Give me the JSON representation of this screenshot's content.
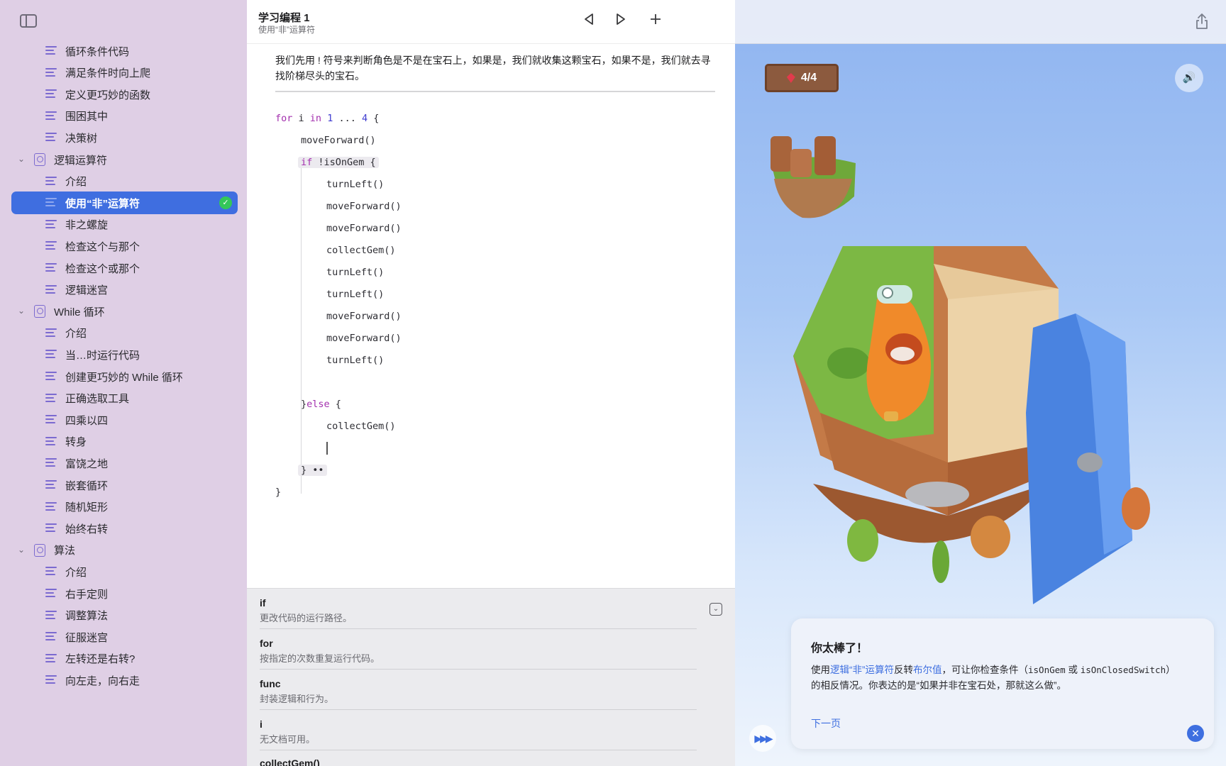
{
  "sidebar": {
    "items": [
      {
        "type": "page",
        "label": "循环条件代码"
      },
      {
        "type": "page",
        "label": "满足条件时向上爬"
      },
      {
        "type": "page",
        "label": "定义更巧妙的函数"
      },
      {
        "type": "page",
        "label": "围困其中"
      },
      {
        "type": "page",
        "label": "决策树"
      },
      {
        "type": "chapter",
        "label": "逻辑运算符"
      },
      {
        "type": "page",
        "label": "介绍"
      },
      {
        "type": "page",
        "label": "使用“非”运算符",
        "selected": true
      },
      {
        "type": "page",
        "label": "非之螺旋"
      },
      {
        "type": "page",
        "label": "检查这个与那个"
      },
      {
        "type": "page",
        "label": "检查这个或那个"
      },
      {
        "type": "page",
        "label": "逻辑迷宫"
      },
      {
        "type": "chapter",
        "label": "While 循环"
      },
      {
        "type": "page",
        "label": "介绍"
      },
      {
        "type": "page",
        "label": "当…时运行代码"
      },
      {
        "type": "page",
        "label": "创建更巧妙的 While 循环"
      },
      {
        "type": "page",
        "label": "正确选取工具"
      },
      {
        "type": "page",
        "label": "四乘以四"
      },
      {
        "type": "page",
        "label": "转身"
      },
      {
        "type": "page",
        "label": "富饶之地"
      },
      {
        "type": "page",
        "label": "嵌套循环"
      },
      {
        "type": "page",
        "label": "随机矩形"
      },
      {
        "type": "page",
        "label": "始终右转"
      },
      {
        "type": "chapter",
        "label": "算法"
      },
      {
        "type": "page",
        "label": "介绍"
      },
      {
        "type": "page",
        "label": "右手定则"
      },
      {
        "type": "page",
        "label": "调整算法"
      },
      {
        "type": "page",
        "label": "征服迷宫"
      },
      {
        "type": "page",
        "label": "左转还是右转?"
      },
      {
        "type": "page",
        "label": "向左走，向右走"
      }
    ]
  },
  "editor": {
    "title": "学习编程 1",
    "subtitle": "使用“非”运算符",
    "intro": "我们先用 ! 符号来判断角色是不是在宝石上，如果是，我们就收集这颗宝石，如果不是，我们就去寻找阶梯尽头的宝石。",
    "code": [
      "for i in 1 ... 4 {",
      "moveForward()",
      "if !isOnGem {",
      "turnLeft()",
      "moveForward()",
      "moveForward()",
      "collectGem()",
      "turnLeft()",
      "turnLeft()",
      "moveForward()",
      "moveForward()",
      "turnLeft()",
      "}else {",
      "collectGem()",
      "} ••",
      "}"
    ]
  },
  "suggestions": [
    {
      "name": "if",
      "desc": "更改代码的运行路径。"
    },
    {
      "name": "for",
      "desc": "按指定的次数重复运行代码。"
    },
    {
      "name": "func",
      "desc": "封装逻辑和行为。"
    },
    {
      "name": "i",
      "desc": "无文档可用。"
    },
    {
      "name": "collectGem()",
      "desc": ""
    }
  ],
  "live_view": {
    "gem_counter": "4/4",
    "success": {
      "title": "你太棒了！",
      "body_prefix": "使用",
      "link1": "逻辑“非”运算符",
      "mid1": "反转",
      "link2": "布尔值",
      "mid2": "，可让你检查条件（",
      "code1": "isOnGem",
      "mid3": " 或 ",
      "code2": "isOnClosedSwitch",
      "suffix": "）的相反情况。你表达的是“如果并非在宝石处，那就这么做”。",
      "next": "下一页"
    }
  },
  "icons": {
    "sidebar_toggle": "sidebar-toggle-icon",
    "back": "triangle-left-icon",
    "run": "play-icon",
    "add": "plus-icon",
    "share": "share-icon",
    "sound": "speaker-icon",
    "fast_forward": "fast-forward-icon",
    "close": "close-icon",
    "collapse": "collapse-icon"
  },
  "colors": {
    "accent": "#3f6ee0",
    "keyword": "#a32fae",
    "number": "#3e3bd0",
    "sidebar_bg": "#dfcfe5",
    "success": "#34c759"
  }
}
